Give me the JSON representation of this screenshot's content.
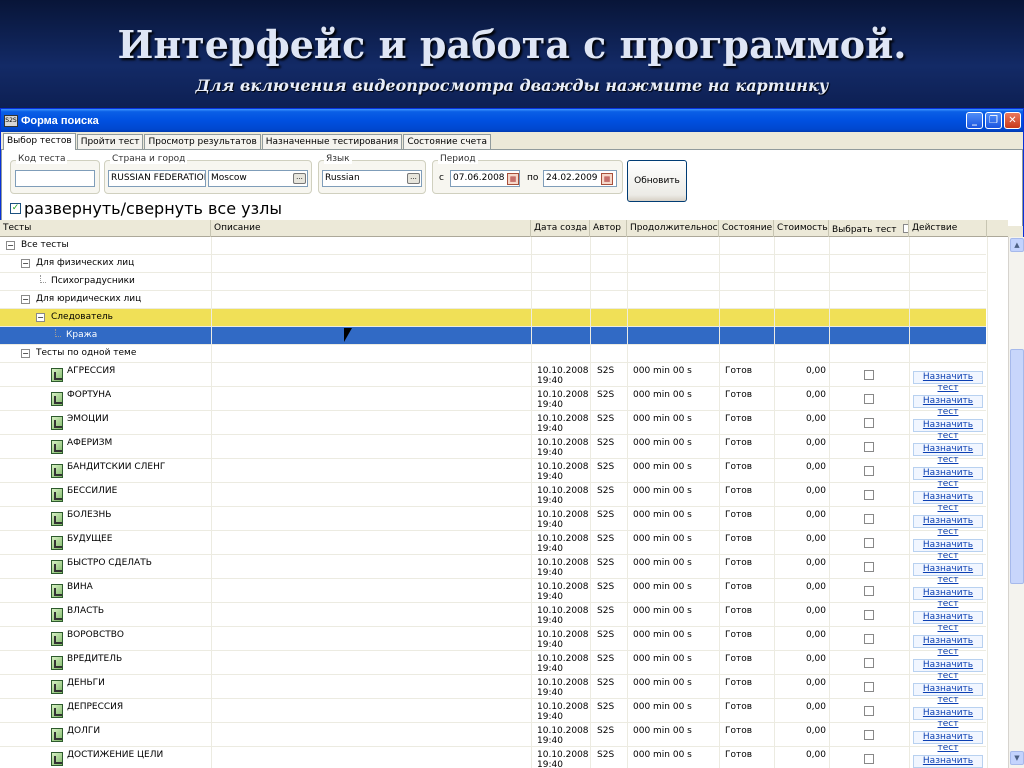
{
  "slide": {
    "title": "Интерфейс и работа с программой.",
    "subtitle": "Для включения видеопросмотра дважды нажмите на картинку"
  },
  "window": {
    "title": "Форма поиска",
    "icon_text": "S2S"
  },
  "tabs": [
    "Выбор тестов",
    "Пройти тест",
    "Просмотр результатов",
    "Назначенные тестирования",
    "Состояние счета"
  ],
  "filters": {
    "code_label": "Код теста",
    "code_value": "",
    "country_label": "Страна и город",
    "country_value": "RUSSIAN FEDERATION",
    "city_value": "Moscow",
    "language_label": "Язык",
    "language_value": "Russian",
    "period_label": "Период",
    "from_label": "с",
    "from_value": "07.06.2008",
    "to_label": "по",
    "to_value": "24.02.2009",
    "refresh_label": "Обновить",
    "expand_label": "развернуть/свернуть все узлы"
  },
  "columns": [
    "Тесты",
    "Описание",
    "Дата созда",
    "Автор",
    "Продолжительность",
    "Состояние",
    "Стоимость",
    "Выбрать тест",
    "Действие"
  ],
  "tree": [
    {
      "label": "Все тесты",
      "level": 0,
      "toggle": "−"
    },
    {
      "label": "Для физических лиц",
      "level": 1,
      "toggle": "−"
    },
    {
      "label": "Психоградусники",
      "level": 2,
      "toggle": ""
    },
    {
      "label": "Для юридических лиц",
      "level": 1,
      "toggle": "−"
    },
    {
      "label": "Следователь",
      "level": 2,
      "toggle": "−",
      "highlight": "yellow"
    },
    {
      "label": "Кража",
      "level": 3,
      "toggle": "",
      "highlight": "blue"
    },
    {
      "label": "Тесты по одной теме",
      "level": 1,
      "toggle": "−"
    }
  ],
  "tests": [
    {
      "name": "АГРЕССИЯ",
      "date": "10.10.2008",
      "time": "19:40",
      "author": "S2S",
      "duration": "000 min 00 s",
      "status": "Готов",
      "cost": "0,00",
      "action": "Назначить тест"
    },
    {
      "name": "ФОРТУНА",
      "date": "10.10.2008",
      "time": "19:40",
      "author": "S2S",
      "duration": "000 min 00 s",
      "status": "Готов",
      "cost": "0,00",
      "action": "Назначить тест"
    },
    {
      "name": "ЭМОЦИИ",
      "date": "10.10.2008",
      "time": "19:40",
      "author": "S2S",
      "duration": "000 min 00 s",
      "status": "Готов",
      "cost": "0,00",
      "action": "Назначить тест"
    },
    {
      "name": "АФЕРИЗМ",
      "date": "10.10.2008",
      "time": "19:40",
      "author": "S2S",
      "duration": "000 min 00 s",
      "status": "Готов",
      "cost": "0,00",
      "action": "Назначить тест"
    },
    {
      "name": "БАНДИТСКИЙ СЛЕНГ",
      "date": "10.10.2008",
      "time": "19:40",
      "author": "S2S",
      "duration": "000 min 00 s",
      "status": "Готов",
      "cost": "0,00",
      "action": "Назначить тест"
    },
    {
      "name": "БЕССИЛИЕ",
      "date": "10.10.2008",
      "time": "19:40",
      "author": "S2S",
      "duration": "000 min 00 s",
      "status": "Готов",
      "cost": "0,00",
      "action": "Назначить тест"
    },
    {
      "name": "БОЛЕЗНЬ",
      "date": "10.10.2008",
      "time": "19:40",
      "author": "S2S",
      "duration": "000 min 00 s",
      "status": "Готов",
      "cost": "0,00",
      "action": "Назначить тест"
    },
    {
      "name": "БУДУЩЕЕ",
      "date": "10.10.2008",
      "time": "19:40",
      "author": "S2S",
      "duration": "000 min 00 s",
      "status": "Готов",
      "cost": "0,00",
      "action": "Назначить тест"
    },
    {
      "name": "БЫСТРО СДЕЛАТЬ",
      "date": "10.10.2008",
      "time": "19:40",
      "author": "S2S",
      "duration": "000 min 00 s",
      "status": "Готов",
      "cost": "0,00",
      "action": "Назначить тест"
    },
    {
      "name": "ВИНА",
      "date": "10.10.2008",
      "time": "19:40",
      "author": "S2S",
      "duration": "000 min 00 s",
      "status": "Готов",
      "cost": "0,00",
      "action": "Назначить тест"
    },
    {
      "name": "ВЛАСТЬ",
      "date": "10.10.2008",
      "time": "19:40",
      "author": "S2S",
      "duration": "000 min 00 s",
      "status": "Готов",
      "cost": "0,00",
      "action": "Назначить тест"
    },
    {
      "name": "ВОРОВСТВО",
      "date": "10.10.2008",
      "time": "19:40",
      "author": "S2S",
      "duration": "000 min 00 s",
      "status": "Готов",
      "cost": "0,00",
      "action": "Назначить тест"
    },
    {
      "name": "ВРЕДИТЕЛЬ",
      "date": "10.10.2008",
      "time": "19:40",
      "author": "S2S",
      "duration": "000 min 00 s",
      "status": "Готов",
      "cost": "0,00",
      "action": "Назначить тест"
    },
    {
      "name": "ДЕНЬГИ",
      "date": "10.10.2008",
      "time": "19:40",
      "author": "S2S",
      "duration": "000 min 00 s",
      "status": "Готов",
      "cost": "0,00",
      "action": "Назначить тест"
    },
    {
      "name": "ДЕПРЕССИЯ",
      "date": "10.10.2008",
      "time": "19:40",
      "author": "S2S",
      "duration": "000 min 00 s",
      "status": "Готов",
      "cost": "0,00",
      "action": "Назначить тест"
    },
    {
      "name": "ДОЛГИ",
      "date": "10.10.2008",
      "time": "19:40",
      "author": "S2S",
      "duration": "000 min 00 s",
      "status": "Готов",
      "cost": "0,00",
      "action": "Назначить тест"
    },
    {
      "name": "ДОСТИЖЕНИЕ ЦЕЛИ",
      "date": "10.10.2008",
      "time": "19:40",
      "author": "S2S",
      "duration": "000 min 00 s",
      "status": "Готов",
      "cost": "0,00",
      "action": "Назначить тест"
    }
  ],
  "colors": {
    "highlight_yellow": "#f0e057",
    "highlight_blue": "#316ac5",
    "titlebar": "#0050e0"
  }
}
